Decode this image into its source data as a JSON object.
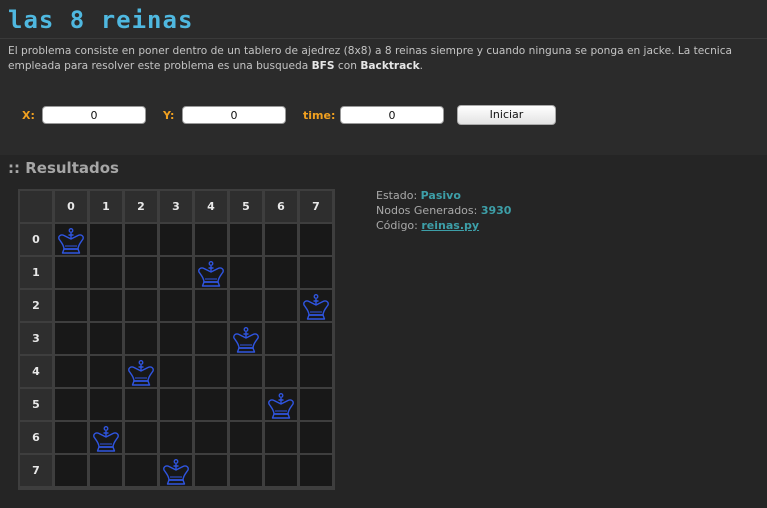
{
  "page": {
    "title": "las 8 reinas",
    "description": {
      "part1": "El problema consiste en poner dentro de un tablero de ajedrez (8x8) a 8 reinas siempre y cuando ninguna se ponga en jacke. La tecnica empleada para resolver este problema es una busqueda ",
      "bfs": "BFS",
      "part2": " con ",
      "backtrack": "Backtrack",
      "part3": "."
    }
  },
  "controls": {
    "x_label": "X:",
    "x_value": "0",
    "y_label": "Y:",
    "y_value": "0",
    "time_label": "time:",
    "time_value": "0",
    "start_button": "Iniciar"
  },
  "results": {
    "title": ":: Resultados",
    "board": {
      "columns": [
        "0",
        "1",
        "2",
        "3",
        "4",
        "5",
        "6",
        "7"
      ],
      "rows": [
        "0",
        "1",
        "2",
        "3",
        "4",
        "5",
        "6",
        "7"
      ],
      "queens": [
        0,
        4,
        7,
        5,
        2,
        6,
        1,
        3
      ],
      "queen_icon": "queen-icon",
      "queen_color": "#2f55e0"
    },
    "info": {
      "estado_label": "Estado:",
      "estado_value": "Pasivo",
      "nodos_label": "Nodos Generados:",
      "nodos_value": "3930",
      "codigo_label": "Código:",
      "codigo_value": "reinas.py"
    }
  }
}
